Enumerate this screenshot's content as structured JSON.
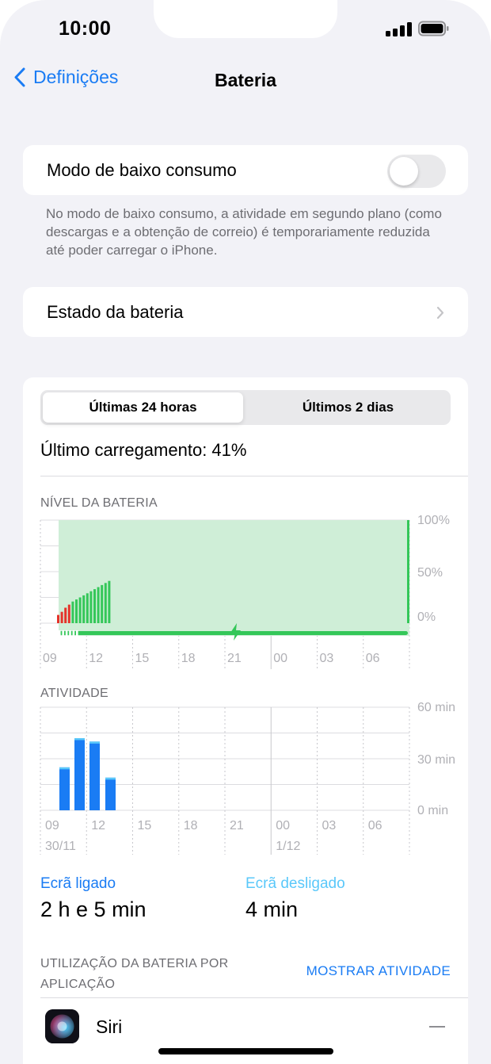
{
  "status": {
    "time": "10:00"
  },
  "nav": {
    "back_label": "Definições",
    "title": "Bateria"
  },
  "low_power": {
    "label": "Modo de baixo consumo",
    "enabled": false,
    "footnote": "No modo de baixo consumo, a atividade em segundo plano (como descargas e a obtenção de correio) é temporariamente reduzida até poder carregar o iPhone."
  },
  "battery_health": {
    "label": "Estado da bateria"
  },
  "segmented": {
    "option_24h": "Últimas 24 horas",
    "option_2d": "Últimos 2 dias",
    "selected": "option_24h"
  },
  "last_charge": "Último carregamento: 41%",
  "battery_level": {
    "title": "NÍVEL DA BATERIA"
  },
  "activity": {
    "title": "ATIVIDADE"
  },
  "chart_data": [
    {
      "type": "bar",
      "title": "NÍVEL DA BATERIA",
      "categories": [
        "09",
        "12",
        "15",
        "18",
        "21",
        "00",
        "03",
        "06"
      ],
      "y_tick_labels": [
        "100%",
        "50%",
        "0%"
      ],
      "ylim": [
        0,
        100
      ],
      "series": [
        {
          "color": "#e5332a",
          "values": [
            8,
            11,
            15,
            18
          ]
        },
        {
          "color": "#34c759",
          "values": [
            21,
            23,
            25,
            27,
            29,
            31,
            33,
            35,
            37,
            39,
            41
          ]
        }
      ],
      "charging_band": "09–06",
      "colors": {
        "low": "#e5332a",
        "normal": "#34c759",
        "charging_fill": "#cfeed7"
      }
    },
    {
      "type": "bar",
      "title": "ATIVIDADE",
      "categories": [
        "09",
        "12",
        "15",
        "18",
        "21",
        "00",
        "03",
        "06"
      ],
      "date_labels": [
        "30/11",
        "1/12"
      ],
      "y_tick_labels": [
        "60 min",
        "30 min",
        "0 min"
      ],
      "ylim": [
        0,
        60
      ],
      "values": [
        25,
        42,
        40,
        19
      ],
      "colors": {
        "screen_on": "#1a7cf4",
        "screen_off": "#5ac8fa"
      }
    }
  ],
  "screen_on": {
    "label": "Ecrã ligado",
    "value": "2 h e 5 min"
  },
  "screen_off": {
    "label": "Ecrã desligado",
    "value": "4 min"
  },
  "usage": {
    "title": "UTILIZAÇÃO DA BATERIA POR APLICAÇÃO",
    "action": "MOSTRAR ATIVIDADE"
  },
  "apps": [
    {
      "name": "Siri",
      "icon": "siri-icon",
      "usage": "—"
    }
  ]
}
